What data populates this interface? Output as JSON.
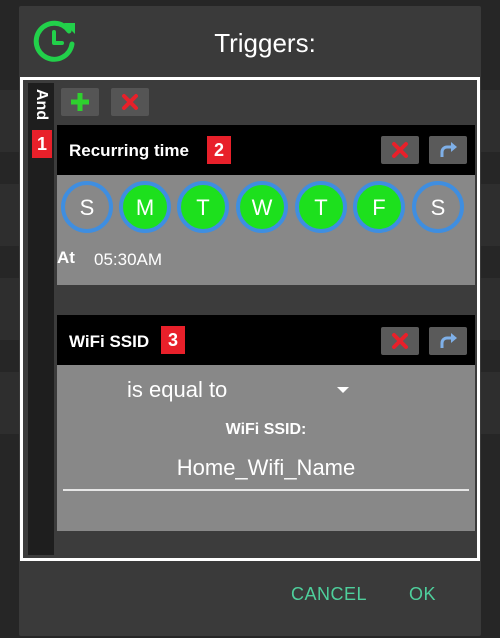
{
  "dialog": {
    "title": "Triggers:",
    "icon": "recurring-clock-icon"
  },
  "group": {
    "operator_label": "And",
    "badge": "1",
    "add_icon": "plus-icon",
    "delete_icon": "close-icon"
  },
  "triggers": [
    {
      "title": "Recurring time",
      "badge": "2",
      "days": [
        {
          "label": "S",
          "selected": false
        },
        {
          "label": "M",
          "selected": true
        },
        {
          "label": "T",
          "selected": true
        },
        {
          "label": "W",
          "selected": true
        },
        {
          "label": "T",
          "selected": true
        },
        {
          "label": "F",
          "selected": true
        },
        {
          "label": "S",
          "selected": false
        }
      ],
      "at_label": "At",
      "time": "05:30AM"
    },
    {
      "title": "WiFi SSID",
      "badge": "3",
      "operator": "is equal to",
      "field_label": "WiFi SSID:",
      "field_value": "Home_Wifi_Name"
    }
  ],
  "footer": {
    "cancel_label": "CANCEL",
    "ok_label": "OK"
  },
  "colors": {
    "accent": "#4ecf9c",
    "day_selected": "#1de01d",
    "day_ring": "#3f8ee0",
    "badge": "#e8202a",
    "delete": "#e8202a",
    "add": "#2ed12e"
  }
}
